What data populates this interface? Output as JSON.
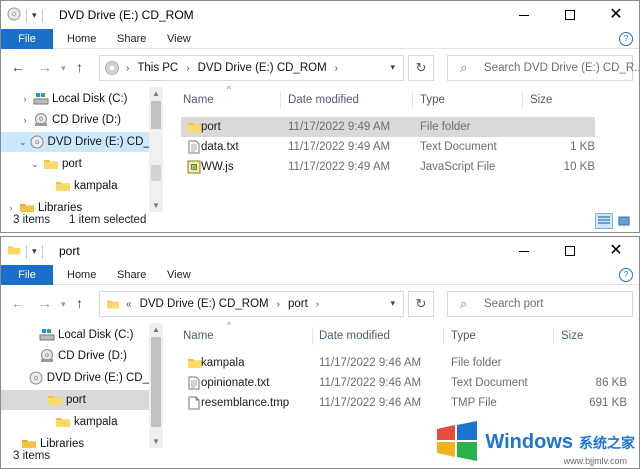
{
  "window_top": {
    "title": "DVD Drive (E:) CD_ROM",
    "ribbon": {
      "file": "File",
      "home": "Home",
      "share": "Share",
      "view": "View"
    },
    "address": {
      "crumbs": [
        "This PC",
        "DVD Drive (E:) CD_ROM"
      ]
    },
    "search_placeholder": "Search DVD Drive (E:) CD_R...",
    "nav_tree": [
      {
        "label": "Local Disk (C:)",
        "icon": "disk-icon"
      },
      {
        "label": "CD Drive (D:)",
        "icon": "cd-drive-icon"
      },
      {
        "label": "DVD Drive (E:) CD_",
        "icon": "dvd-icon",
        "selected": true
      },
      {
        "label": "port",
        "icon": "folder-icon"
      },
      {
        "label": "kampala",
        "icon": "folder-icon"
      },
      {
        "label": "Libraries",
        "icon": "libraries-icon"
      }
    ],
    "columns": {
      "name": "Name",
      "date": "Date modified",
      "type": "Type",
      "size": "Size"
    },
    "files": [
      {
        "name": "port",
        "date": "11/17/2022 9:49 AM",
        "type": "File folder",
        "size": "",
        "icon": "folder-icon",
        "selected": true
      },
      {
        "name": "data.txt",
        "date": "11/17/2022 9:49 AM",
        "type": "Text Document",
        "size": "1 KB",
        "icon": "text-file-icon"
      },
      {
        "name": "WW.js",
        "date": "11/17/2022 9:49 AM",
        "type": "JavaScript File",
        "size": "10 KB",
        "icon": "js-file-icon"
      }
    ],
    "status": {
      "count": "3 items",
      "selection": "1 item selected"
    }
  },
  "window_bottom": {
    "title": "port",
    "ribbon": {
      "file": "File",
      "home": "Home",
      "share": "Share",
      "view": "View"
    },
    "address": {
      "prefix": "«",
      "crumbs": [
        "DVD Drive (E:) CD_ROM",
        "port"
      ]
    },
    "search_placeholder": "Search port",
    "nav_tree": [
      {
        "label": "Local Disk (C:)",
        "icon": "disk-icon"
      },
      {
        "label": "CD Drive (D:)",
        "icon": "cd-drive-icon"
      },
      {
        "label": "DVD Drive (E:) CD_",
        "icon": "dvd-icon"
      },
      {
        "label": "port",
        "icon": "folder-icon",
        "selected": true
      },
      {
        "label": "kampala",
        "icon": "folder-icon"
      },
      {
        "label": "Libraries",
        "icon": "libraries-icon"
      }
    ],
    "columns": {
      "name": "Name",
      "date": "Date modified",
      "type": "Type",
      "size": "Size"
    },
    "files": [
      {
        "name": "kampala",
        "date": "11/17/2022 9:46 AM",
        "type": "File folder",
        "size": "",
        "icon": "folder-icon"
      },
      {
        "name": "opinionate.txt",
        "date": "11/17/2022 9:46 AM",
        "type": "Text Document",
        "size": "86 KB",
        "icon": "text-file-icon"
      },
      {
        "name": "resemblance.tmp",
        "date": "11/17/2022 9:46 AM",
        "type": "TMP File",
        "size": "691 KB",
        "icon": "tmp-file-icon"
      }
    ],
    "status": {
      "count": "3 items"
    }
  },
  "watermark": {
    "brand": "Windows",
    "cn_text": "系统之家",
    "url": "www.bjjmlv.com"
  }
}
